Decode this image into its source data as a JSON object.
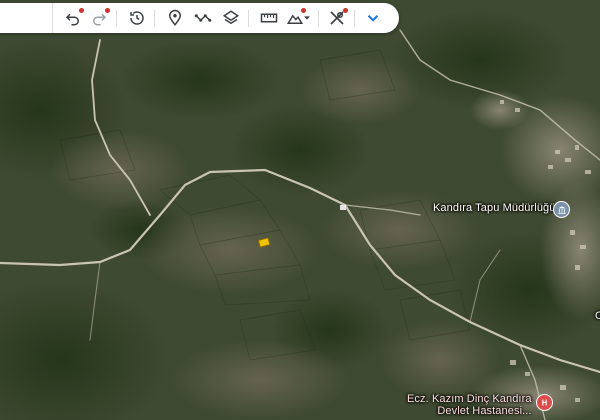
{
  "toolbar": {
    "buttons": [
      {
        "name": "undo-button",
        "icon": "undo-icon",
        "dot": true
      },
      {
        "name": "redo-button",
        "icon": "redo-icon",
        "dot": true
      },
      {
        "name": "history-button",
        "icon": "history-icon",
        "dot": false
      },
      {
        "name": "add-placemark-button",
        "icon": "placemark-icon",
        "dot": false
      },
      {
        "name": "add-path-button",
        "icon": "path-icon",
        "dot": false
      },
      {
        "name": "layers-button",
        "icon": "layers-icon",
        "dot": false
      },
      {
        "name": "measure-button",
        "icon": "ruler-icon",
        "dot": false
      },
      {
        "name": "elevation-button",
        "icon": "mountain-icon",
        "dot": true
      },
      {
        "name": "tools-button",
        "icon": "tools-icon",
        "dot": true
      },
      {
        "name": "collapse-button",
        "icon": "chevron-down-icon",
        "dot": false
      }
    ],
    "accent_color": "#1a73e8",
    "dot_color": "#d93025"
  },
  "map": {
    "labels": {
      "tapu": "Kandıra Tapu Müdürlüğü",
      "hospital_line1": "Ecz. Kazım Dinç Kandıra",
      "hospital_line2": "Devlet Hastanesi...",
      "partial": "O"
    },
    "marker_color": "#f2c200",
    "hospital_color": "#e04a4a"
  }
}
